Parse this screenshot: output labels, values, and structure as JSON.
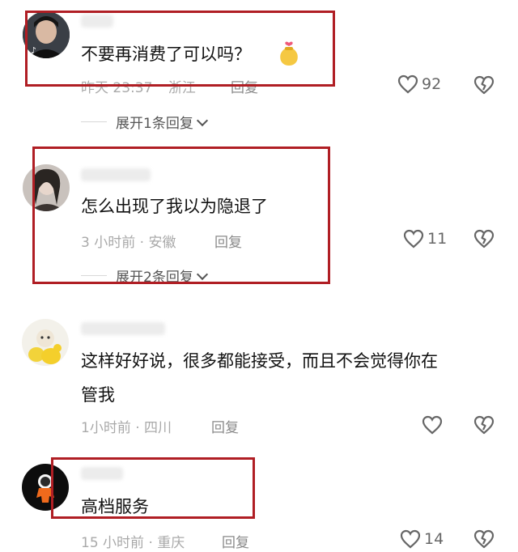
{
  "comments": [
    {
      "text": "不要再消费了可以吗？",
      "time": "昨天 23:37",
      "location": "浙江",
      "reply_label": "回复",
      "likes": "92",
      "expand": "展开1条回复"
    },
    {
      "text": "怎么出现了我以为隐退了",
      "time": "3 小时前",
      "location": "安徽",
      "reply_label": "回复",
      "likes": "11",
      "expand": "展开2条回复"
    },
    {
      "text_line1": "这样好好说，很多都能接受，而且不会觉得你在",
      "text_line2": "管我",
      "time": "1小时前",
      "location": "四川",
      "reply_label": "回复",
      "likes": ""
    },
    {
      "text": "高档服务",
      "time": "15 小时前",
      "location": "重庆",
      "reply_label": "回复",
      "likes": "14"
    }
  ],
  "separator": "·",
  "colors": {
    "highlight_border": "#b01e24",
    "meta_text": "#a9a9a9",
    "body_text": "#111111"
  },
  "icons": {
    "like": "heart-outline-icon",
    "dislike": "broken-heart-icon",
    "sticker": "money-bag-emoji-icon"
  }
}
